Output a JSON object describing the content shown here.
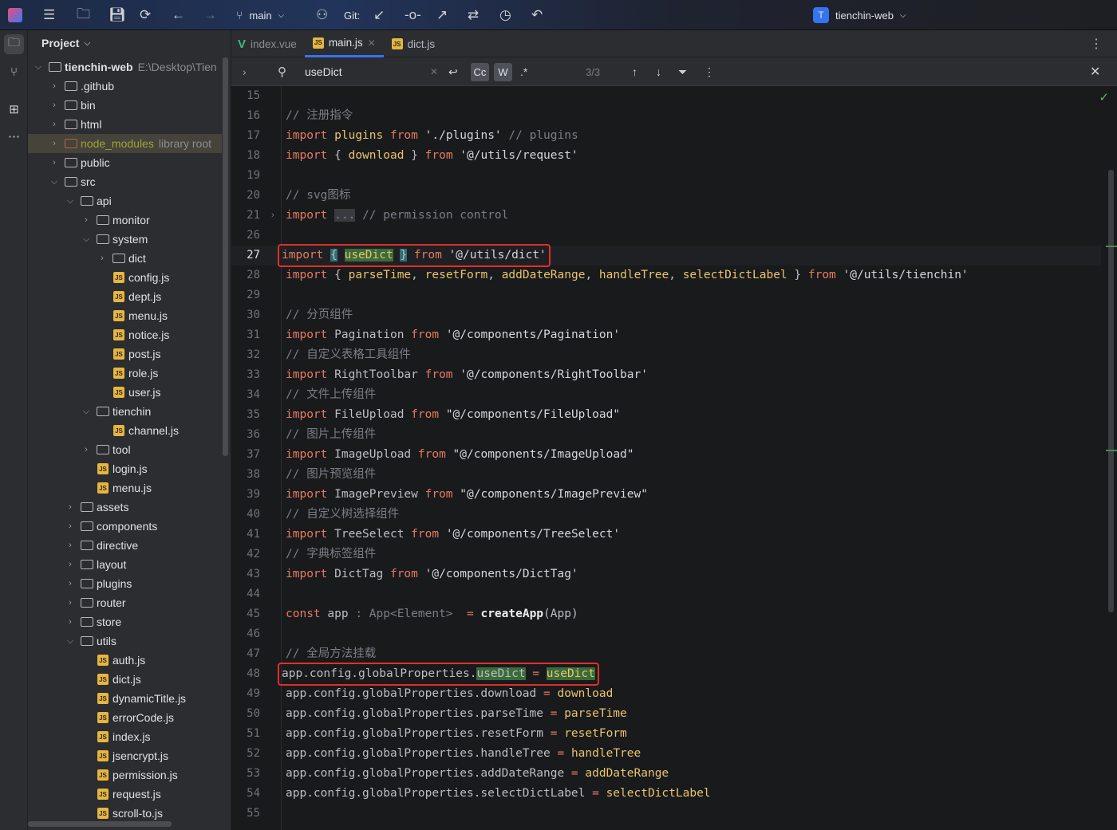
{
  "topbar": {
    "branch": "main",
    "git_label": "Git:",
    "project_badge": "T",
    "project_name": "tienchin-web"
  },
  "project_panel": {
    "title": "Project",
    "items": [
      {
        "label": "tienchin-web",
        "hint": "E:\\Desktop\\Tien",
        "level": 0,
        "type": "root",
        "expanded": true
      },
      {
        "label": ".github",
        "level": 1,
        "type": "folder",
        "expanded": false
      },
      {
        "label": "bin",
        "level": 1,
        "type": "folder",
        "expanded": false
      },
      {
        "label": "html",
        "level": 1,
        "type": "folder",
        "expanded": false
      },
      {
        "label": "node_modules",
        "hint": "library root",
        "level": 1,
        "type": "lib",
        "expanded": false,
        "selected": true
      },
      {
        "label": "public",
        "level": 1,
        "type": "folder",
        "expanded": false
      },
      {
        "label": "src",
        "level": 1,
        "type": "folder",
        "expanded": true
      },
      {
        "label": "api",
        "level": 2,
        "type": "folder",
        "expanded": true
      },
      {
        "label": "monitor",
        "level": 3,
        "type": "folder",
        "expanded": false
      },
      {
        "label": "system",
        "level": 3,
        "type": "folder",
        "expanded": true
      },
      {
        "label": "dict",
        "level": 4,
        "type": "folder",
        "expanded": false
      },
      {
        "label": "config.js",
        "level": 4,
        "type": "js"
      },
      {
        "label": "dept.js",
        "level": 4,
        "type": "js"
      },
      {
        "label": "menu.js",
        "level": 4,
        "type": "js"
      },
      {
        "label": "notice.js",
        "level": 4,
        "type": "js"
      },
      {
        "label": "post.js",
        "level": 4,
        "type": "js"
      },
      {
        "label": "role.js",
        "level": 4,
        "type": "js"
      },
      {
        "label": "user.js",
        "level": 4,
        "type": "js"
      },
      {
        "label": "tienchin",
        "level": 3,
        "type": "folder",
        "expanded": true
      },
      {
        "label": "channel.js",
        "level": 4,
        "type": "js"
      },
      {
        "label": "tool",
        "level": 3,
        "type": "folder",
        "expanded": false
      },
      {
        "label": "login.js",
        "level": 3,
        "type": "js"
      },
      {
        "label": "menu.js",
        "level": 3,
        "type": "js"
      },
      {
        "label": "assets",
        "level": 2,
        "type": "folder",
        "expanded": false
      },
      {
        "label": "components",
        "level": 2,
        "type": "folder",
        "expanded": false
      },
      {
        "label": "directive",
        "level": 2,
        "type": "folder",
        "expanded": false
      },
      {
        "label": "layout",
        "level": 2,
        "type": "folder",
        "expanded": false
      },
      {
        "label": "plugins",
        "level": 2,
        "type": "folder",
        "expanded": false
      },
      {
        "label": "router",
        "level": 2,
        "type": "folder",
        "expanded": false
      },
      {
        "label": "store",
        "level": 2,
        "type": "folder",
        "expanded": false
      },
      {
        "label": "utils",
        "level": 2,
        "type": "folder",
        "expanded": true
      },
      {
        "label": "auth.js",
        "level": 3,
        "type": "js"
      },
      {
        "label": "dict.js",
        "level": 3,
        "type": "js"
      },
      {
        "label": "dynamicTitle.js",
        "level": 3,
        "type": "js"
      },
      {
        "label": "errorCode.js",
        "level": 3,
        "type": "js"
      },
      {
        "label": "index.js",
        "level": 3,
        "type": "js"
      },
      {
        "label": "jsencrypt.js",
        "level": 3,
        "type": "js"
      },
      {
        "label": "permission.js",
        "level": 3,
        "type": "js"
      },
      {
        "label": "request.js",
        "level": 3,
        "type": "js"
      },
      {
        "label": "scroll-to.js",
        "level": 3,
        "type": "js"
      }
    ]
  },
  "tabs": [
    {
      "label": "index.vue",
      "icon": "vue-icon"
    },
    {
      "label": "main.js",
      "icon": "js-icon",
      "active": true
    },
    {
      "label": "dict.js",
      "icon": "js-icon"
    }
  ],
  "search": {
    "query": "useDict",
    "match_case": "Cc",
    "words": "W",
    "regex": ".*",
    "count": "3/3"
  },
  "colors": {
    "keyword": "#e57a60",
    "identifier": "#eac46b",
    "comment": "#7a7e85",
    "highlight": "#3a6b3a",
    "box": "#e0302a",
    "accent": "#3574f0"
  },
  "code": [
    {
      "n": "15",
      "t": []
    },
    {
      "n": "16",
      "t": [
        [
          "cm",
          "// 注册指令"
        ]
      ]
    },
    {
      "n": "17",
      "t": [
        [
          "kw",
          "import"
        ],
        [
          "p",
          " "
        ],
        [
          "id",
          "plugins"
        ],
        [
          "p",
          " "
        ],
        [
          "kw",
          "from"
        ],
        [
          "p",
          " "
        ],
        [
          "str",
          "'./plugins'"
        ],
        [
          "p",
          " "
        ],
        [
          "cm",
          "// plugins"
        ]
      ]
    },
    {
      "n": "18",
      "t": [
        [
          "kw",
          "import"
        ],
        [
          "p",
          " { "
        ],
        [
          "id",
          "download"
        ],
        [
          "p",
          " } "
        ],
        [
          "kw",
          "from"
        ],
        [
          "p",
          " "
        ],
        [
          "str",
          "'@/utils/request'"
        ]
      ]
    },
    {
      "n": "19",
      "t": []
    },
    {
      "n": "20",
      "t": [
        [
          "cm",
          "// svg图标"
        ]
      ]
    },
    {
      "n": "21",
      "fold": true,
      "t": [
        [
          "kw",
          "import"
        ],
        [
          "p",
          " "
        ],
        [
          "foldbox",
          "..."
        ],
        [
          "p",
          " "
        ],
        [
          "cm",
          "// permission control"
        ]
      ]
    },
    {
      "n": "26",
      "t": []
    },
    {
      "n": "27",
      "cur": true,
      "boxed": true,
      "t": [
        [
          "kw",
          "import"
        ],
        [
          "p",
          " "
        ],
        [
          "brace",
          "{"
        ],
        [
          "p",
          " "
        ],
        [
          "id hl",
          "useDict"
        ],
        [
          "p",
          " "
        ],
        [
          "brace",
          "}"
        ],
        [
          "p",
          " "
        ],
        [
          "kw",
          "from"
        ],
        [
          "p",
          " "
        ],
        [
          "str",
          "'@/utils/dict'"
        ]
      ]
    },
    {
      "n": "28",
      "t": [
        [
          "kw",
          "import"
        ],
        [
          "p",
          " { "
        ],
        [
          "id",
          "parseTime"
        ],
        [
          "p",
          ", "
        ],
        [
          "id",
          "resetForm"
        ],
        [
          "p",
          ", "
        ],
        [
          "id",
          "addDateRange"
        ],
        [
          "p",
          ", "
        ],
        [
          "id",
          "handleTree"
        ],
        [
          "p",
          ", "
        ],
        [
          "id",
          "selectDictLabel"
        ],
        [
          "p",
          " } "
        ],
        [
          "kw",
          "from"
        ],
        [
          "p",
          " "
        ],
        [
          "str",
          "'@/utils/tienchin'"
        ]
      ]
    },
    {
      "n": "29",
      "t": []
    },
    {
      "n": "30",
      "t": [
        [
          "cm",
          "// 分页组件"
        ]
      ]
    },
    {
      "n": "31",
      "t": [
        [
          "kw",
          "import"
        ],
        [
          "p",
          " Pagination "
        ],
        [
          "kw",
          "from"
        ],
        [
          "p",
          " "
        ],
        [
          "str",
          "'@/components/Pagination'"
        ]
      ]
    },
    {
      "n": "32",
      "t": [
        [
          "cm",
          "// 自定义表格工具组件"
        ]
      ]
    },
    {
      "n": "33",
      "t": [
        [
          "kw",
          "import"
        ],
        [
          "p",
          " RightToolbar "
        ],
        [
          "kw",
          "from"
        ],
        [
          "p",
          " "
        ],
        [
          "str",
          "'@/components/RightToolbar'"
        ]
      ]
    },
    {
      "n": "34",
      "t": [
        [
          "cm",
          "// 文件上传组件"
        ]
      ]
    },
    {
      "n": "35",
      "t": [
        [
          "kw",
          "import"
        ],
        [
          "p",
          " FileUpload "
        ],
        [
          "kw",
          "from"
        ],
        [
          "p",
          " "
        ],
        [
          "str",
          "\"@/components/FileUpload\""
        ]
      ]
    },
    {
      "n": "36",
      "t": [
        [
          "cm",
          "// 图片上传组件"
        ]
      ]
    },
    {
      "n": "37",
      "t": [
        [
          "kw",
          "import"
        ],
        [
          "p",
          " ImageUpload "
        ],
        [
          "kw",
          "from"
        ],
        [
          "p",
          " "
        ],
        [
          "str",
          "\"@/components/ImageUpload\""
        ]
      ]
    },
    {
      "n": "38",
      "t": [
        [
          "cm",
          "// 图片预览组件"
        ]
      ]
    },
    {
      "n": "39",
      "t": [
        [
          "kw",
          "import"
        ],
        [
          "p",
          " ImagePreview "
        ],
        [
          "kw",
          "from"
        ],
        [
          "p",
          " "
        ],
        [
          "str",
          "\"@/components/ImagePreview\""
        ]
      ]
    },
    {
      "n": "40",
      "t": [
        [
          "cm",
          "// 自定义树选择组件"
        ]
      ]
    },
    {
      "n": "41",
      "t": [
        [
          "kw",
          "import"
        ],
        [
          "p",
          " TreeSelect "
        ],
        [
          "kw",
          "from"
        ],
        [
          "p",
          " "
        ],
        [
          "str",
          "'@/components/TreeSelect'"
        ]
      ]
    },
    {
      "n": "42",
      "t": [
        [
          "cm",
          "// 字典标签组件"
        ]
      ]
    },
    {
      "n": "43",
      "t": [
        [
          "kw",
          "import"
        ],
        [
          "p",
          " DictTag "
        ],
        [
          "kw",
          "from"
        ],
        [
          "p",
          " "
        ],
        [
          "str",
          "'@/components/DictTag'"
        ]
      ]
    },
    {
      "n": "44",
      "t": []
    },
    {
      "n": "45",
      "t": [
        [
          "kw",
          "const"
        ],
        [
          "p",
          " app "
        ],
        [
          "hint",
          ": App<Element> "
        ],
        [
          "p",
          " "
        ],
        [
          "kw",
          "="
        ],
        [
          "p",
          " "
        ],
        [
          "fn",
          "createApp"
        ],
        [
          "p",
          "(App)"
        ]
      ]
    },
    {
      "n": "46",
      "t": []
    },
    {
      "n": "47",
      "t": [
        [
          "cm",
          "// 全局方法挂载"
        ]
      ]
    },
    {
      "n": "48",
      "boxed": true,
      "t": [
        [
          "p",
          "app.config.globalProperties."
        ],
        [
          "p hl",
          "useDict"
        ],
        [
          "p",
          " "
        ],
        [
          "kw",
          "="
        ],
        [
          "p",
          " "
        ],
        [
          "id hl",
          "useDict"
        ]
      ]
    },
    {
      "n": "49",
      "t": [
        [
          "p",
          "app.config.globalProperties.download "
        ],
        [
          "kw",
          "="
        ],
        [
          "p",
          " "
        ],
        [
          "id",
          "download"
        ]
      ]
    },
    {
      "n": "50",
      "t": [
        [
          "p",
          "app.config.globalProperties.parseTime "
        ],
        [
          "kw",
          "="
        ],
        [
          "p",
          " "
        ],
        [
          "id",
          "parseTime"
        ]
      ]
    },
    {
      "n": "51",
      "t": [
        [
          "p",
          "app.config.globalProperties.resetForm "
        ],
        [
          "kw",
          "="
        ],
        [
          "p",
          " "
        ],
        [
          "id",
          "resetForm"
        ]
      ]
    },
    {
      "n": "52",
      "t": [
        [
          "p",
          "app.config.globalProperties.handleTree "
        ],
        [
          "kw",
          "="
        ],
        [
          "p",
          " "
        ],
        [
          "id",
          "handleTree"
        ]
      ]
    },
    {
      "n": "53",
      "t": [
        [
          "p",
          "app.config.globalProperties.addDateRange "
        ],
        [
          "kw",
          "="
        ],
        [
          "p",
          " "
        ],
        [
          "id",
          "addDateRange"
        ]
      ]
    },
    {
      "n": "54",
      "t": [
        [
          "p",
          "app.config.globalProperties.selectDictLabel "
        ],
        [
          "kw",
          "="
        ],
        [
          "p",
          " "
        ],
        [
          "id",
          "selectDictLabel"
        ]
      ]
    },
    {
      "n": "55",
      "t": []
    }
  ]
}
